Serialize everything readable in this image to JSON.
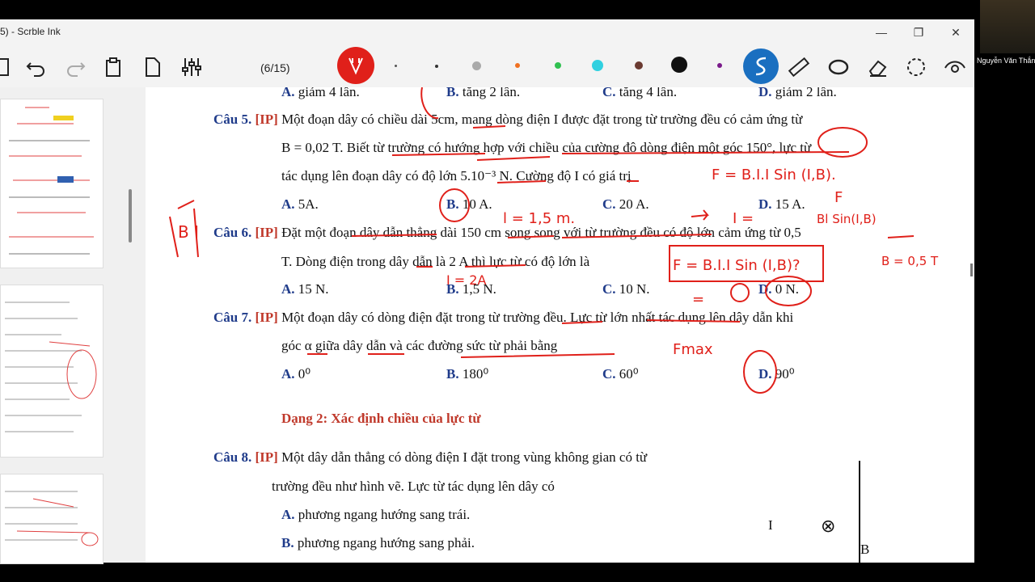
{
  "window": {
    "title": "5) - Scrble Ink",
    "minimize": "—",
    "maximize": "❐",
    "close": "✕"
  },
  "toolbar": {
    "page_indicator": "(6/15)"
  },
  "colors": {
    "pen_red": "#e0201a",
    "accent_blue": "#1a6fc0",
    "question_blue": "#1f3b8a",
    "label_red": "#c0392b"
  },
  "pen_colors": [
    "#555555",
    "#333333",
    "#aaaaaa",
    "#f07020",
    "#30c050",
    "#30d0e0",
    "#6a3a30",
    "#111111",
    "#7a1a8a"
  ],
  "user": {
    "name": "Nguyễn Văn Thắng"
  },
  "document": {
    "top_options": [
      "A. giảm 4 lần.",
      "B. tăng 2 lần.",
      "C. tăng 4 lần.",
      "D. giảm 2 lần."
    ],
    "q5": {
      "label": "Câu 5.",
      "tag": "[IP]",
      "line1": "Một đoạn dây có chiều dài 5cm, mang dòng điện I được đặt trong từ trường đều có cảm ứng từ",
      "line2": "B = 0,02 T. Biết từ trường có hướng hợp với chiều của cường độ dòng điện một góc 150°, lực từ",
      "line3": "tác dụng lên đoạn dây có độ lớn 5.10⁻³ N. Cường độ I có giá trị",
      "options": [
        "A. 5A.",
        "B. 10 A.",
        "C. 20 A.",
        "D. 15 A."
      ]
    },
    "q6": {
      "label": "Câu 6.",
      "tag": "[IP]",
      "line1": "Đặt một đoạn dây dẫn thẳng dài 150 cm song song với từ trường đều có độ lớn cảm ứng từ 0,5",
      "line2": "T. Dòng điện trong dây dẫn là 2 A thì lực từ có độ lớn là",
      "options": [
        "A. 15 N.",
        "B. 1,5 N.",
        "C. 10 N.",
        "D. 0 N."
      ]
    },
    "q7": {
      "label": "Câu 7.",
      "tag": "[IP]",
      "line1": "Một đoạn dây có dòng điện đặt trong từ trường đều. Lực từ lớn nhất tác dụng lên dây dẫn khi",
      "line2": "góc α giữa dây dẫn và các đường sức từ phải bằng",
      "options": [
        "A. 0⁰",
        "B. 180⁰",
        "C. 60⁰",
        "D. 90⁰"
      ]
    },
    "section": "Dạng 2: Xác định chiều của lực từ",
    "q8": {
      "label": "Câu 8.",
      "tag": "[IP]",
      "line1": "Một dây dẫn thẳng có dòng điện I đặt trong vùng không gian có từ",
      "line2": "trường đều như hình vẽ. Lực từ tác dụng lên dây có",
      "options": [
        "A. phương ngang hướng sang trái.",
        "B. phương ngang hướng sang phải."
      ],
      "figure": {
        "current": "I",
        "cross": "⊗",
        "field": "B"
      }
    }
  },
  "annotations": {
    "formula1": "F = B.I.I Sin (I,B).",
    "formula2_num": "F",
    "formula2_den": "Bl Sin(I,B)",
    "i_eq": "I =",
    "length": "l = 1,5 m.",
    "b_val": "B = 0,5 T",
    "i_val": "I = 2A",
    "formula3": "F = B.I.I Sin (I,B)?",
    "eq": "=",
    "fmax": "Fmax",
    "vec": "B  I"
  }
}
